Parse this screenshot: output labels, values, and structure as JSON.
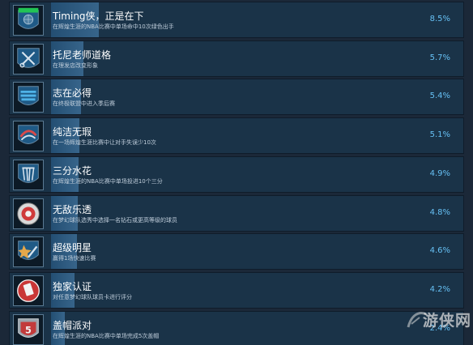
{
  "achievements": [
    {
      "title": "Timing侠，正是在下",
      "description": "在辉煌生涯的NBA比赛中单场命中10次绿色出手",
      "percent": "8.5%",
      "percent_value": 8.5,
      "icon": "basketball-player-icon"
    },
    {
      "title": "托尼老师道格",
      "description": "在理发店改变形象",
      "percent": "5.7%",
      "percent_value": 5.7,
      "icon": "scissors-comb-icon"
    },
    {
      "title": "志在必得",
      "description": "在终极联盟中进入季后赛",
      "percent": "5.4%",
      "percent_value": 5.4,
      "icon": "shield-stripes-icon"
    },
    {
      "title": "纯洁无瑕",
      "description": "在一场辉煌生涯比赛中让对手失误少10次",
      "percent": "5.1%",
      "percent_value": 5.1,
      "icon": "swoosh-shield-icon"
    },
    {
      "title": "三分水花",
      "description": "在辉煌生涯的NBA比赛中单场投进10个三分",
      "percent": "4.9%",
      "percent_value": 4.9,
      "icon": "net-splash-icon"
    },
    {
      "title": "无敌乐透",
      "description": "在梦幻球队选秀中选择一名钻石或更高等级的球员",
      "percent": "4.8%",
      "percent_value": 4.8,
      "icon": "lottery-ball-icon"
    },
    {
      "title": "超级明星",
      "description": "赢得1场快速比赛",
      "percent": "4.6%",
      "percent_value": 4.6,
      "icon": "star-player-icon"
    },
    {
      "title": "独家认证",
      "description": "对任意梦幻球队球员卡进行评分",
      "percent": "4.2%",
      "percent_value": 4.2,
      "icon": "card-stamp-icon"
    },
    {
      "title": "盖帽派对",
      "description": "在辉煌生涯的NBA比赛中单场完成5次盖帽",
      "percent": "2.4%",
      "percent_value": 2.4,
      "icon": "number-five-shield-icon"
    }
  ],
  "watermark": {
    "text": "游侠网"
  }
}
